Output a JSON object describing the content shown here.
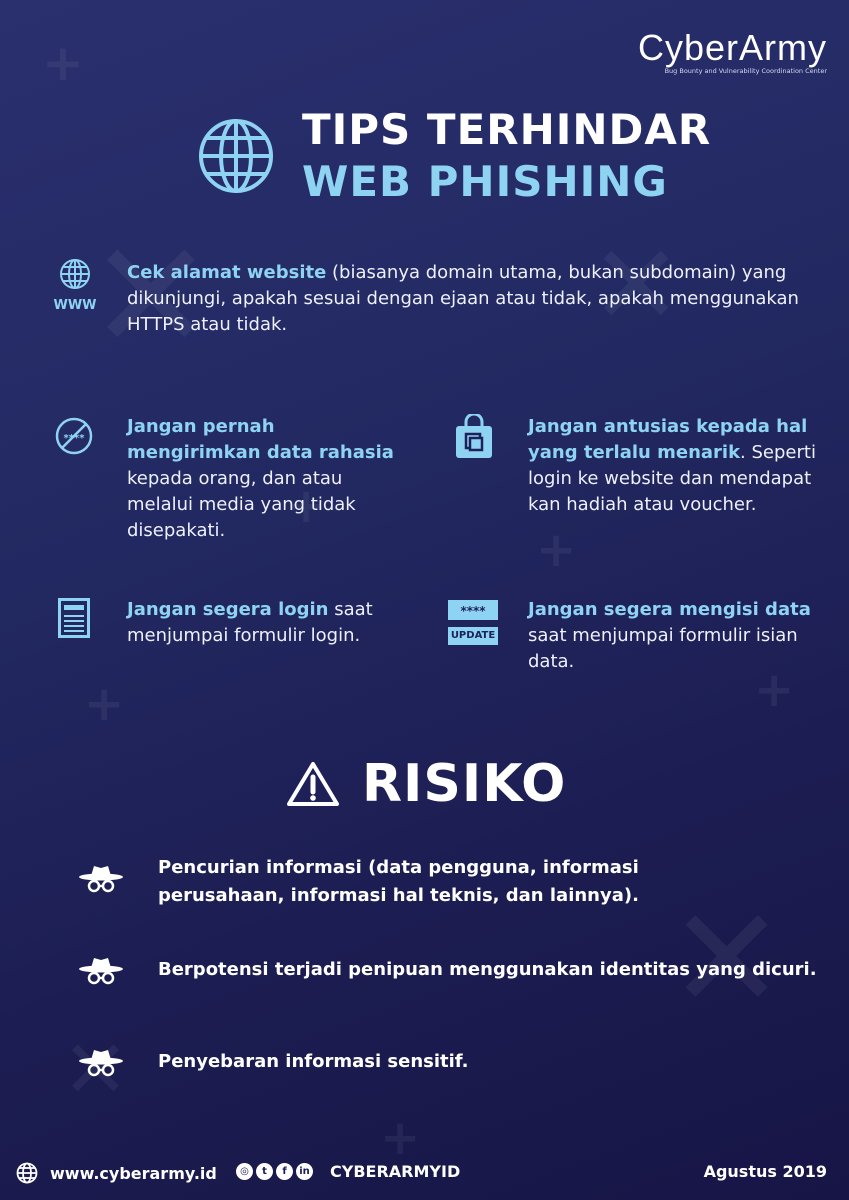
{
  "brand": {
    "name": "CyberArmy",
    "tagline": "Bug Bounty and Vulnerability Coordination Center"
  },
  "title": {
    "line1": "TIPS TERHINDAR",
    "line2": "WEB PHISHING"
  },
  "tips": [
    {
      "icon": "www-globe-icon",
      "highlight": "Cek alamat website",
      "text": " (biasanya domain utama, bukan subdomain) yang dikunjungi, apakah sesuai dengan ejaan atau tidak, apakah menggunakan HTTPS atau tidak.",
      "icon_label": "WWW"
    },
    {
      "icon": "no-password-icon",
      "highlight": "Jangan pernah mengirimkan data rahasia",
      "text": " kepada orang, dan atau melalui media yang tidak disepakati."
    },
    {
      "icon": "shopping-bag-icon",
      "highlight": "Jangan antusias kepada hal yang terlalu menarik",
      "text": ". Seperti login ke website dan mendapat kan hadiah atau voucher."
    },
    {
      "icon": "login-form-icon",
      "highlight": "Jangan segera login",
      "text": " saat menjumpai formulir login."
    },
    {
      "icon": "update-form-icon",
      "highlight": "Jangan segera mengisi data",
      "text": " saat menjumpai formulir isian data.",
      "icon_label_top": "****",
      "icon_label_bottom": "UPDATE"
    }
  ],
  "risk": {
    "title": "RISIKO",
    "items": [
      "Pencurian informasi (data pengguna, informasi perusahaan, informasi hal teknis, dan lainnya).",
      "Berpotensi terjadi penipuan menggunakan identitas yang dicuri.",
      "Penyebaran informasi sensitif."
    ]
  },
  "footer": {
    "website": "www.cyberarmy.id",
    "handle": "CYBERARMYID",
    "date": "Agustus 2019"
  },
  "colors": {
    "accent": "#8fd3f2",
    "background_start": "#2a2f6e",
    "background_end": "#171546"
  }
}
